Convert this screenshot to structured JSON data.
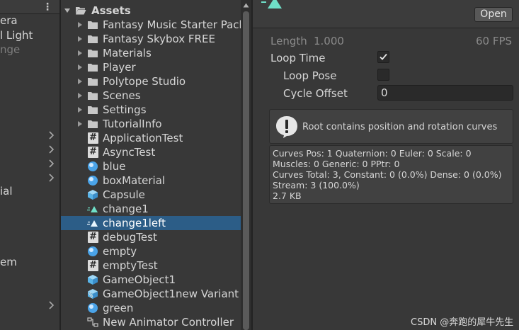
{
  "hierarchy": {
    "items": [
      {
        "label": "era",
        "dim": false
      },
      {
        "label": "l Light",
        "dim": false
      },
      {
        "label": "nge",
        "dim": true
      },
      {
        "label": "ial",
        "dim": false
      },
      {
        "label": "em",
        "dim": false
      }
    ]
  },
  "project": {
    "root_label": "Assets",
    "folders": [
      {
        "label": "Fantasy Music Starter Pack"
      },
      {
        "label": "Fantasy Skybox FREE"
      },
      {
        "label": "Materials"
      },
      {
        "label": "Player"
      },
      {
        "label": "Polytope Studio"
      },
      {
        "label": "Scenes"
      },
      {
        "label": "Settings"
      },
      {
        "label": "TutorialInfo"
      }
    ],
    "assets": [
      {
        "label": "ApplicationTest",
        "icon": "script-icon",
        "selected": false
      },
      {
        "label": "AsyncTest",
        "icon": "script-icon",
        "selected": false
      },
      {
        "label": "blue",
        "icon": "material-icon",
        "selected": false
      },
      {
        "label": "boxMaterial",
        "icon": "material-icon",
        "selected": false
      },
      {
        "label": "Capsule",
        "icon": "prefab-icon",
        "selected": false
      },
      {
        "label": "change1",
        "icon": "animation-clip-icon",
        "selected": false
      },
      {
        "label": "change1left",
        "icon": "animation-clip-icon",
        "selected": true
      },
      {
        "label": "debugTest",
        "icon": "script-icon",
        "selected": false
      },
      {
        "label": "empty",
        "icon": "material-icon",
        "selected": false
      },
      {
        "label": "emptyTest",
        "icon": "script-icon",
        "selected": false
      },
      {
        "label": "GameObject1",
        "icon": "prefab-icon",
        "selected": false
      },
      {
        "label": "GameObject1new Variant",
        "icon": "prefab-variant-icon",
        "selected": false
      },
      {
        "label": "green",
        "icon": "material-icon",
        "selected": false
      },
      {
        "label": "New Animator Controller",
        "icon": "animator-controller-icon",
        "selected": false
      }
    ]
  },
  "inspector": {
    "open_label": "Open",
    "length_label": "Length",
    "length_value": "1.000",
    "fps": "60 FPS",
    "loop_time_label": "Loop Time",
    "loop_time_checked": true,
    "loop_pose_label": "Loop Pose",
    "loop_pose_checked": false,
    "cycle_offset_label": "Cycle Offset",
    "cycle_offset_value": "0",
    "help_message": "Root contains position and rotation curves",
    "stats": [
      "Curves Pos: 1 Quaternion: 0 Euler: 0 Scale: 0",
      "Muscles: 0 Generic: 0 PPtr: 0",
      "Curves Total: 3, Constant: 0 (0.0%) Dense: 0 (0.0%)",
      "Stream: 3 (100.0%)",
      "2.7 KB"
    ]
  },
  "watermark": "CSDN @奔跑的犀牛先生",
  "colors": {
    "selection": "#2c5d87",
    "folder": "#c7c7c7",
    "material": "#4aa3e8",
    "prefab": "#59b4e8",
    "animation": "#6fe0c8"
  }
}
